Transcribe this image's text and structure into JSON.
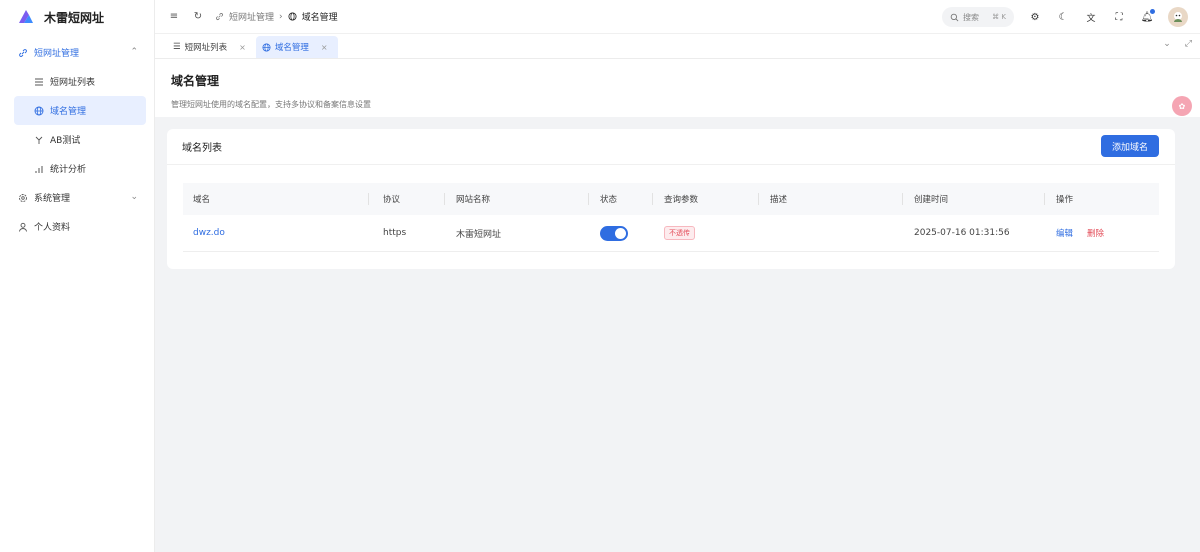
{
  "brand": {
    "title": "木雷短网址"
  },
  "sidebar": {
    "items": [
      {
        "label": "短网址管理",
        "icon": "link-icon"
      },
      {
        "label": "短网址列表",
        "icon": "list-icon"
      },
      {
        "label": "域名管理",
        "icon": "globe-icon"
      },
      {
        "label": "AB测试",
        "icon": "split-icon"
      },
      {
        "label": "统计分析",
        "icon": "bar-chart-icon"
      },
      {
        "label": "系统管理",
        "icon": "gear-icon"
      },
      {
        "label": "个人资料",
        "icon": "user-icon"
      }
    ]
  },
  "header": {
    "breadcrumb": [
      "短网址管理",
      "域名管理"
    ],
    "search_placeholder": "搜索",
    "search_shortcut": "⌘ K"
  },
  "tabs": [
    {
      "label": "短网址列表"
    },
    {
      "label": "域名管理"
    }
  ],
  "page": {
    "title": "域名管理",
    "description": "管理短网址使用的域名配置，支持多协议和备案信息设置"
  },
  "card": {
    "title": "域名列表",
    "add_button": "添加域名"
  },
  "table": {
    "columns": [
      "域名",
      "协议",
      "网站名称",
      "状态",
      "查询参数",
      "描述",
      "创建时间",
      "操作"
    ],
    "rows": [
      {
        "domain": "dwz.do",
        "protocol": "https",
        "site_name": "木雷短网址",
        "status_on": true,
        "query_param": "不透传",
        "description": "",
        "created": "2025-07-16 01:31:56",
        "edit": "编辑",
        "delete": "删除"
      }
    ]
  },
  "colors": {
    "accent": "#2f6de1",
    "danger": "#e34d59"
  }
}
